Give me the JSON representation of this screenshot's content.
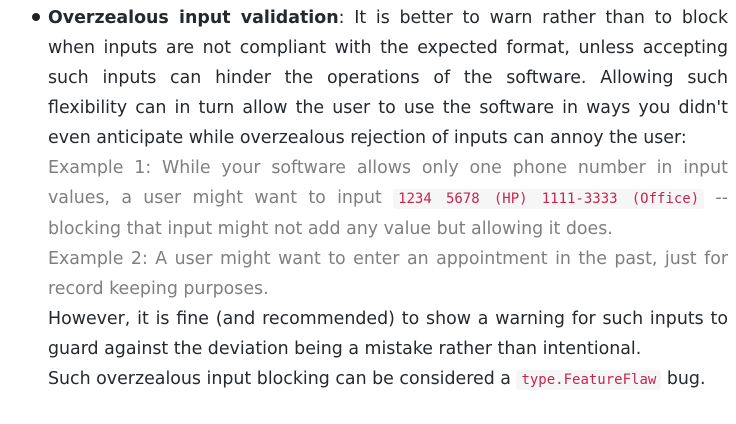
{
  "item": {
    "title": "Overzealous input validation",
    "intro": ": It is better to warn rather than to block when inputs are not compliant with the expected format, unless accepting such inputs can hinder the operations of the software. Allowing such flexibility can in turn allow the user to use the software in ways you didn't even anticipate while overzealous rejection of inputs can annoy the user:",
    "example1_pre": "Example 1: While your software allows only one phone number in input values, a user might want to input ",
    "example1_code": "1234 5678 (HP) 1111-3333 (Office)",
    "example1_post": " -- blocking that input might not add any value but allowing it does.",
    "example2": "Example 2: A user might want to enter an appointment in the past, just for record keeping purposes.",
    "note": "However, it is fine (and recommended) to show a warning for such inputs to guard against the deviation being a mistake rather than intentional.",
    "closing_pre": "Such overzealous input blocking can be considered a ",
    "closing_code": "type.FeatureFlaw",
    "closing_post": " bug."
  }
}
